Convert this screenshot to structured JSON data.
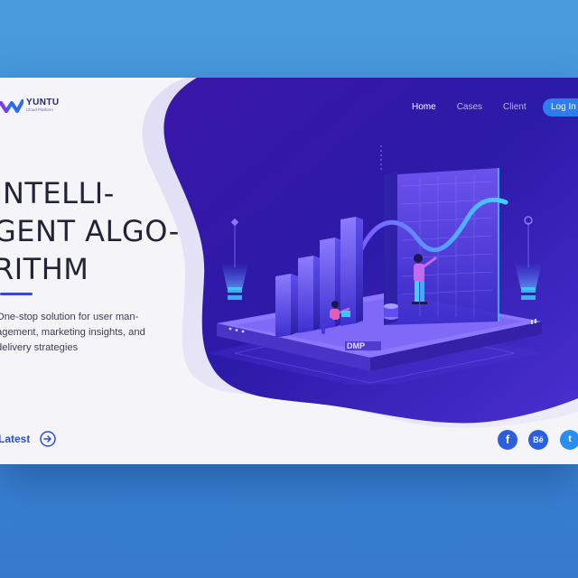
{
  "brand": {
    "name": "YUNTU",
    "tagline": "Cloud Platform"
  },
  "nav": {
    "items": [
      "Home",
      "Cases",
      "Client"
    ],
    "active": "Home",
    "login_label": "Log In"
  },
  "hero": {
    "headline_lines": [
      "INTELLI-",
      "GENT ALGO-",
      "RITHM"
    ],
    "description_lines": [
      "One-stop solution for user man-",
      "agement, marketing insights, and",
      "delivery strategies"
    ],
    "cta_label": "Latest",
    "platform_label": "DMP"
  },
  "social": [
    "facebook-icon",
    "behance-icon",
    "twitter-icon"
  ],
  "social_glyphs": {
    "facebook": "f",
    "behance": "Bē",
    "twitter": "t"
  },
  "colors": {
    "page_bg": "#4a9bdd",
    "card_bg": "#f5f4f9",
    "hero_dark": "#3a1bb5",
    "accent_blue": "#2d7cf0",
    "cyan": "#3fd2ff"
  }
}
